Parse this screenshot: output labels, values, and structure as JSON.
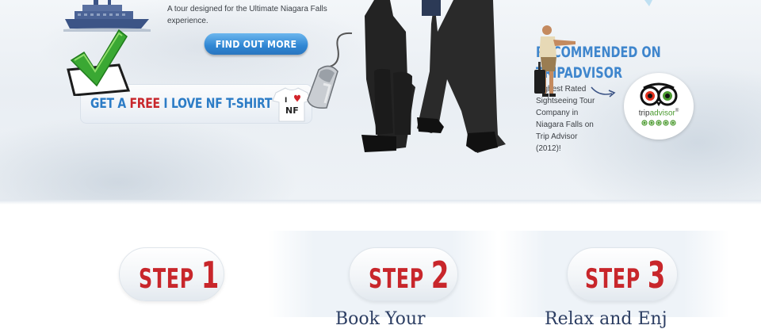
{
  "hero": {
    "tour_description": "A tour designed for the Ultimate Niagara Falls experience.",
    "find_out_more_label": "FIND OUT MORE",
    "tshirt_offer": {
      "prefix": "GET A ",
      "highlight": "FREE",
      "suffix": " I LOVE NF T-SHIRT",
      "shirt_text_top": "I",
      "shirt_text_bottom": "NF"
    },
    "recommended": {
      "title_line1": "RECOMMENDED ON",
      "title_line2": "TRIPADVISOR",
      "description": "Highest Rated Sightseeing Tour Company in Niagara Falls on Trip Advisor (2012)!",
      "badge_word_part1": "trip",
      "badge_word_part2": "advisor",
      "badge_mark": "®"
    }
  },
  "steps": [
    {
      "label": "STEP",
      "number": "1",
      "caption": ""
    },
    {
      "label": "STEP",
      "number": "2",
      "caption": "Book Your"
    },
    {
      "label": "STEP",
      "number": "3",
      "caption": "Relax and Enj"
    }
  ],
  "colors": {
    "accent_blue": "#3f86cd",
    "step_red": "#c8262b",
    "button_blue": "#2f86d3",
    "tripadvisor_green": "#4b9a2f"
  },
  "icons": [
    "boat-icon",
    "tshirt-icon",
    "tripadvisor-owl-icon",
    "arrow-icon",
    "checkmark-icon",
    "mouse-icon",
    "traveler-icon"
  ]
}
